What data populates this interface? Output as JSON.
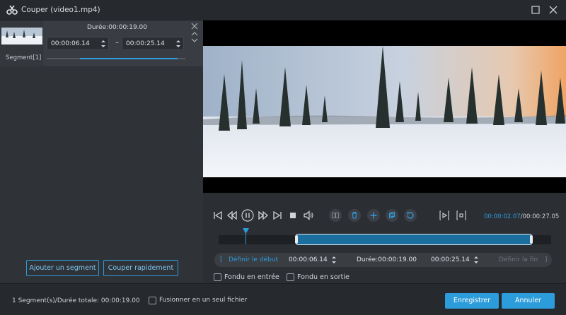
{
  "window": {
    "title": "Couper (video1.mp4)",
    "logo_icon": "scissors-icon"
  },
  "segment_panel": {
    "segment_label": "Segment[1]",
    "duration_label": "Durée:00:00:19.00",
    "start_time": "00:00:06.14",
    "end_time": "00:00:25.14",
    "dash": "–",
    "add_segment_label": "Ajouter un segment",
    "quick_cut_label": "Couper rapidement"
  },
  "player": {
    "current_time": "00:00:02.07",
    "total_time": "/00:00:27.05"
  },
  "timeline": {
    "set_start_label": "Définir le début",
    "start_time": "00:00:06.14",
    "duration_label": "Durée:00:00:19.00",
    "end_time": "00:00:25.14",
    "set_end_label": "Définir la fin",
    "bracket_open": "[",
    "bracket_close": "]"
  },
  "options": {
    "fade_in_label": "Fondu en entrée",
    "fade_out_label": "Fondu en sortie",
    "merge_label": "Fusionner en un seul fichier"
  },
  "footer": {
    "summary": "1 Segment(s)/Durée totale: 00:00:19.00",
    "save_label": "Enregistrer",
    "cancel_label": "Annuler"
  },
  "colors": {
    "accent": "#2d9cdb",
    "background": "#2b2e33",
    "panel": "#2f3237"
  }
}
